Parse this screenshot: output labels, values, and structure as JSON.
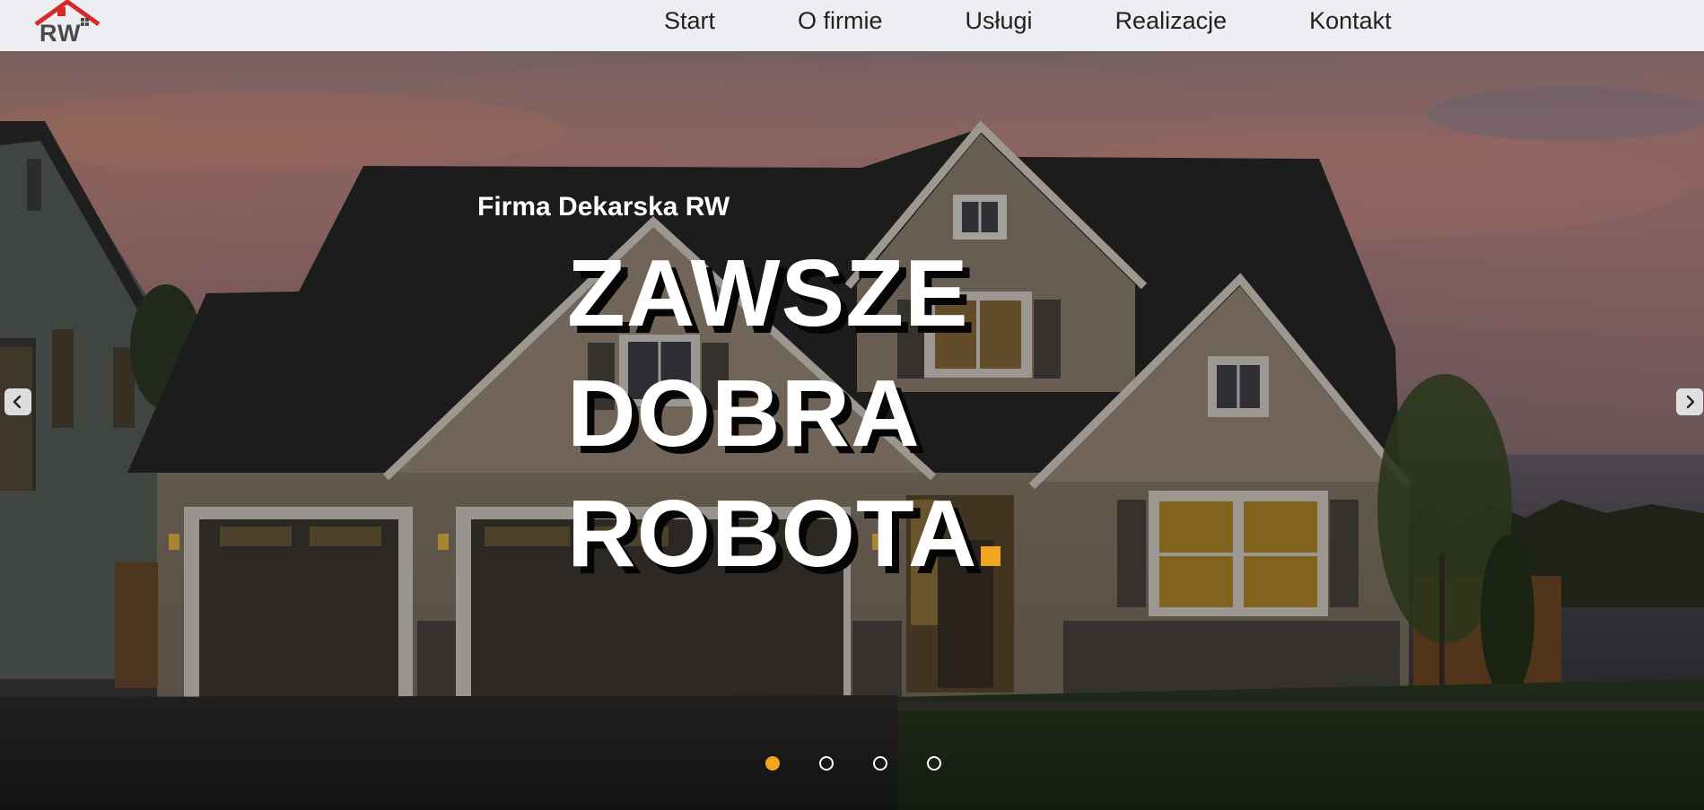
{
  "header": {
    "logo_text": "RW",
    "nav": [
      {
        "label": "Start"
      },
      {
        "label": "O firmie"
      },
      {
        "label": "Usługi"
      },
      {
        "label": "Realizacje"
      },
      {
        "label": "Kontakt"
      }
    ]
  },
  "hero": {
    "tagline": "Firma Dekarska RW",
    "headline_lines": [
      "ZAWSZE",
      "DOBRA",
      "ROBOTA"
    ],
    "slides_count": 4,
    "active_slide": 1
  },
  "colors": {
    "accent": "#f2a51e",
    "logo_roof": "#d62828",
    "header_bg": "#eceef1",
    "text_dark": "#222222",
    "text_light": "#ffffff"
  },
  "icons": {
    "prev": "chevron-left-icon",
    "next": "chevron-right-icon"
  }
}
